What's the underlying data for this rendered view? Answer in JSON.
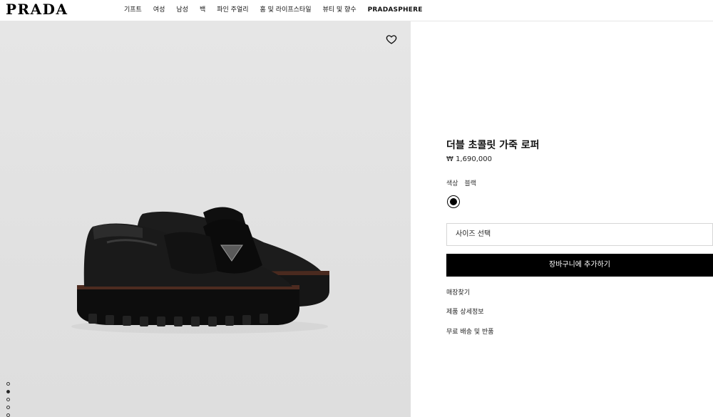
{
  "header": {
    "logo": "PRADA",
    "nav": [
      {
        "label": "기프트"
      },
      {
        "label": "여성"
      },
      {
        "label": "남성"
      },
      {
        "label": "백"
      },
      {
        "label": "파인 주얼리"
      },
      {
        "label": "홈 및 라이프스타일"
      },
      {
        "label": "뷰티 및 향수"
      },
      {
        "label": "PRADASPHERE"
      }
    ]
  },
  "gallery": {
    "wishlist_icon": "heart-icon",
    "slide_count": 5,
    "active_slide": 2
  },
  "product": {
    "title": "더블 초콜릿 가죽 로퍼",
    "price": "₩ 1,690,000",
    "color_label": "색상",
    "color_value": "블랙",
    "swatch_color": "#000000",
    "size_placeholder": "사이즈 선택",
    "add_to_cart": "장바구니에 추가하기",
    "links": [
      "매장찾기",
      "제품 상세정보",
      "무료 배송 및 반품"
    ]
  },
  "colors": {
    "background": "#ffffff",
    "image_bg": "#e3e3e3",
    "button_bg": "#000000",
    "button_text": "#ffffff"
  }
}
